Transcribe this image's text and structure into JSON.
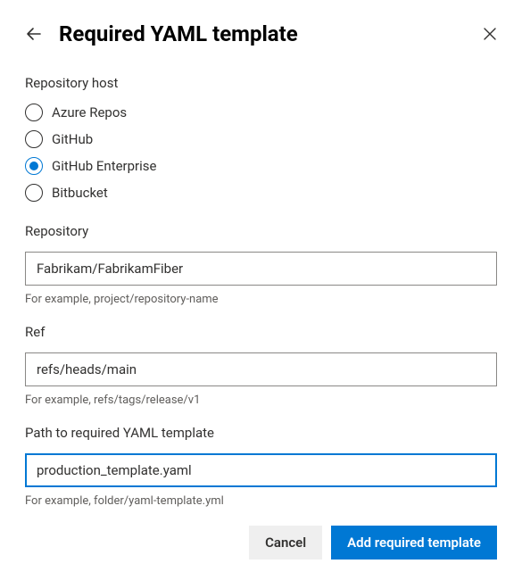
{
  "header": {
    "title": "Required YAML template"
  },
  "host": {
    "label": "Repository host",
    "options": [
      {
        "label": "Azure Repos",
        "selected": false
      },
      {
        "label": "GitHub",
        "selected": false
      },
      {
        "label": "GitHub Enterprise",
        "selected": true
      },
      {
        "label": "Bitbucket",
        "selected": false
      }
    ]
  },
  "repository": {
    "label": "Repository",
    "value": "Fabrikam/FabrikamFiber",
    "hint": "For example, project/repository-name"
  },
  "ref": {
    "label": "Ref",
    "value": "refs/heads/main",
    "hint": "For example, refs/tags/release/v1"
  },
  "path": {
    "label": "Path to required YAML template",
    "value": "production_template.yaml",
    "hint": "For example, folder/yaml-template.yml"
  },
  "actions": {
    "cancel": "Cancel",
    "submit": "Add required template"
  }
}
